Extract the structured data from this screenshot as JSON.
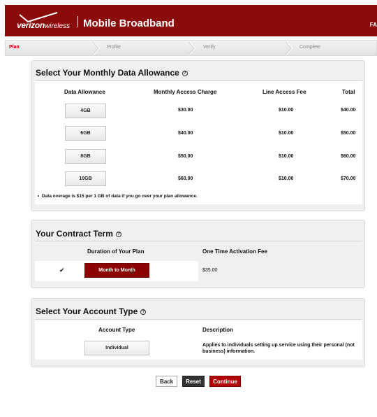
{
  "header": {
    "brand_main": "verizon",
    "brand_sub": "wireless",
    "title": "Mobile Broadband",
    "faq_label": "FA"
  },
  "steps": [
    {
      "label": "Plan"
    },
    {
      "label": "Profile"
    },
    {
      "label": "Verify"
    },
    {
      "label": "Complete"
    }
  ],
  "data_allowance": {
    "title": "Select Your Monthly Data Allowance",
    "headers": [
      "Data Allowance",
      "Monthly Access Charge",
      "Line Access Fee",
      "Total"
    ],
    "rows": [
      {
        "allowance": "4GB",
        "monthly": "$30.00",
        "line": "$10.00",
        "total": "$40.00"
      },
      {
        "allowance": "6GB",
        "monthly": "$40.00",
        "line": "$10.00",
        "total": "$50.00"
      },
      {
        "allowance": "8GB",
        "monthly": "$50.00",
        "line": "$10.00",
        "total": "$60.00"
      },
      {
        "allowance": "10GB",
        "monthly": "$60.00",
        "line": "$10.00",
        "total": "$70.00"
      }
    ],
    "note": "Data overage is $15 per 1 GB of data if you go over your plan allowance."
  },
  "contract": {
    "title": "Your Contract Term",
    "headers": [
      "Duration of Your Plan",
      "One Time Activation Fee"
    ],
    "option_label": "Month to Month",
    "fee": "$35.00",
    "check": "✔"
  },
  "account": {
    "title": "Select Your Account Type",
    "headers": [
      "Account Type",
      "Description"
    ],
    "option_label": "Individual",
    "description": "Applies to individuals setting up service using their personal (not business) information."
  },
  "buttons": {
    "back": "Back",
    "reset": "Reset",
    "continue": "Continue"
  },
  "colors": {
    "brand_red": "#8b0a0a",
    "active_step": "#cc0000",
    "continue": "#b30000"
  }
}
